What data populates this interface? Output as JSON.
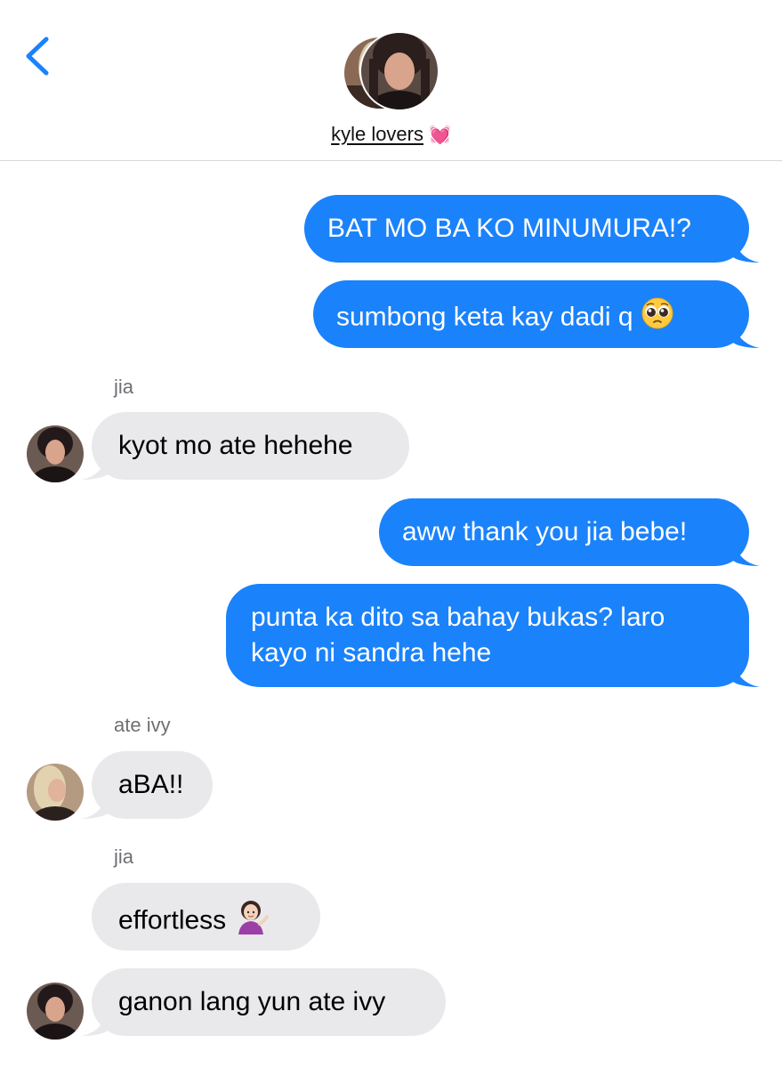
{
  "header": {
    "group_name": "kyle lovers",
    "group_emoji": "💓"
  },
  "messages": [
    {
      "from": "me",
      "text": "BAT MO BA KO MINUMURA!?"
    },
    {
      "from": "me",
      "text": "sumbong keta kay dadi q",
      "emoji": "pleading-face-icon"
    },
    {
      "from": "jia",
      "sender_label": "jia",
      "text": "kyot mo ate hehehe"
    },
    {
      "from": "me",
      "text": "aww thank you jia bebe!"
    },
    {
      "from": "me",
      "text": "punta ka dito sa bahay bukas? laro kayo ni sandra hehe"
    },
    {
      "from": "ate ivy",
      "sender_label": "ate ivy",
      "text": "aBA!!"
    },
    {
      "from": "jia",
      "sender_label": "jia",
      "text": "effortless",
      "emoji": "person-tipping-hand-icon"
    },
    {
      "from": "jia",
      "text": "ganon lang yun ate ivy"
    }
  ],
  "colors": {
    "sent_bubble": "#1a82fb",
    "received_bubble": "#e9e9eb",
    "accent": "#1a82fb"
  }
}
